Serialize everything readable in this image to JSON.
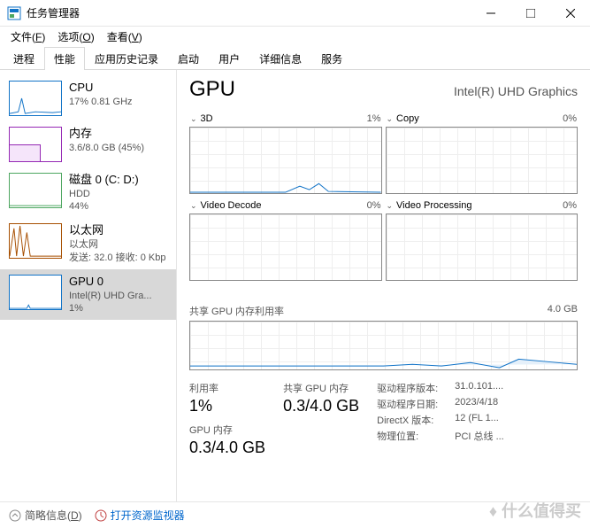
{
  "window": {
    "title": "任务管理器",
    "minimize": "—",
    "maximize": "□",
    "close": "×"
  },
  "menu": {
    "file": "文件(F)",
    "options": "选项(O)",
    "view": "查看(V)"
  },
  "tabs": {
    "processes": "进程",
    "performance": "性能",
    "history": "应用历史记录",
    "startup": "启动",
    "users": "用户",
    "details": "详细信息",
    "services": "服务"
  },
  "sidebar": {
    "cpu": {
      "title": "CPU",
      "sub": "17%  0.81 GHz"
    },
    "mem": {
      "title": "内存",
      "sub": "3.6/8.0 GB (45%)"
    },
    "disk": {
      "title": "磁盘 0 (C: D:)",
      "sub1": "HDD",
      "sub2": "44%"
    },
    "net": {
      "title": "以太网",
      "sub1": "以太网",
      "sub2": "发送: 32.0  接收: 0 Kbp"
    },
    "gpu": {
      "title": "GPU 0",
      "sub1": "Intel(R) UHD Gra...",
      "sub2": "1%"
    }
  },
  "main": {
    "title": "GPU",
    "device": "Intel(R) UHD Graphics",
    "charts": {
      "c3d": {
        "label": "3D",
        "pct": "1%"
      },
      "copy": {
        "label": "Copy",
        "pct": "0%"
      },
      "decode": {
        "label": "Video Decode",
        "pct": "0%"
      },
      "process": {
        "label": "Video Processing",
        "pct": "0%"
      }
    },
    "shared": {
      "label": "共享 GPU 内存利用率",
      "max": "4.0 GB"
    },
    "stats": {
      "util_label": "利用率",
      "util_val": "1%",
      "shared_label": "共享 GPU 内存",
      "shared_val": "0.3/4.0 GB",
      "gpu_mem_label": "GPU 内存",
      "gpu_mem_val": "0.3/4.0 GB"
    },
    "details": {
      "drv_ver_l": "驱动程序版本:",
      "drv_ver_v": "31.0.101....",
      "drv_date_l": "驱动程序日期:",
      "drv_date_v": "2023/4/18",
      "dx_l": "DirectX 版本:",
      "dx_v": "12 (FL 1...",
      "loc_l": "物理位置:",
      "loc_v": "PCI 总线 ..."
    }
  },
  "footer": {
    "fewer": "简略信息(D)",
    "resmon": "打开资源监视器"
  },
  "watermark": "♦ 什么值得买"
}
